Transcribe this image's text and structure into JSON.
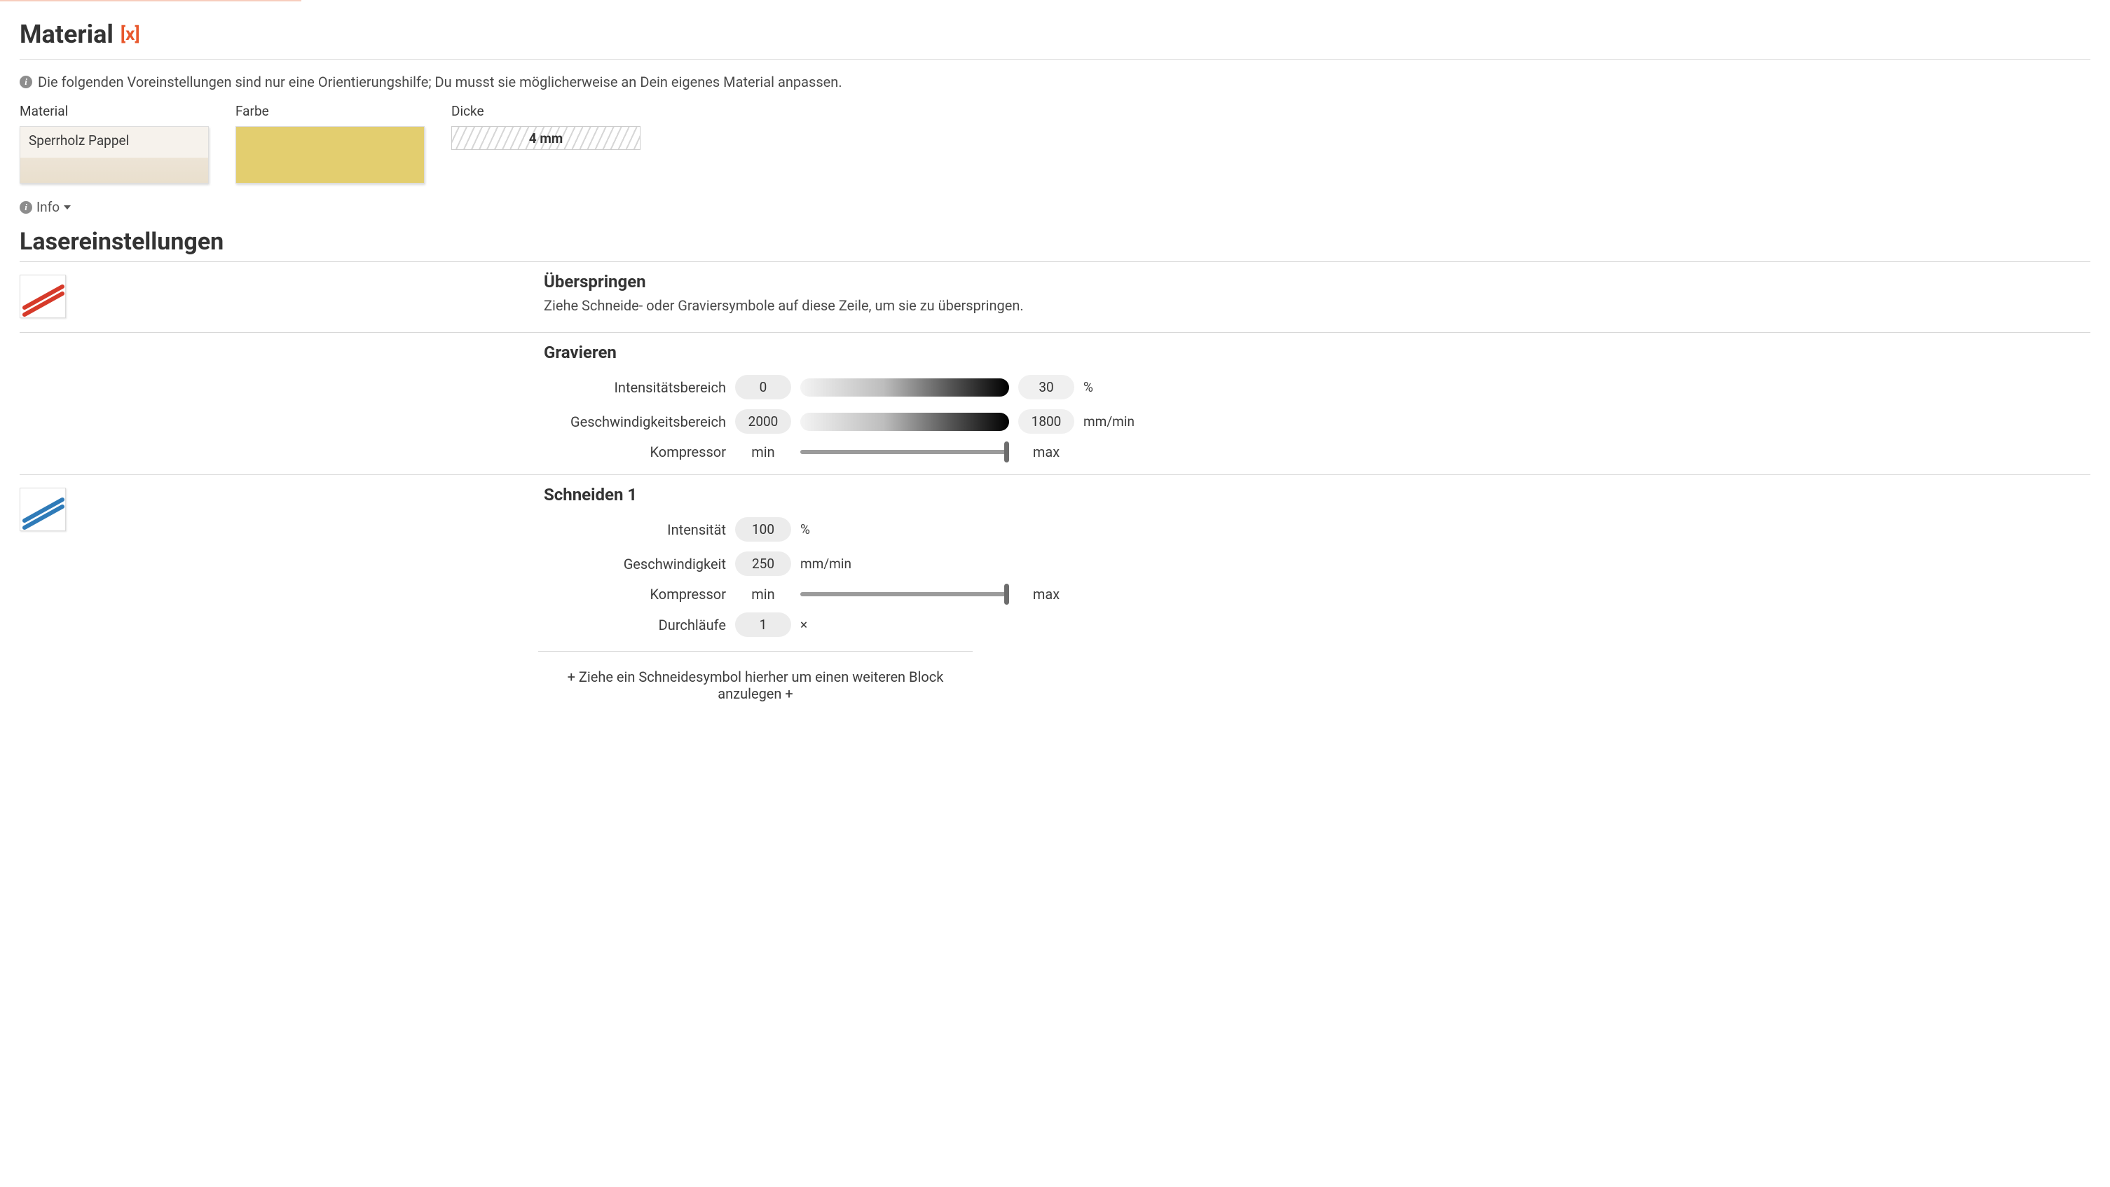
{
  "header": {
    "title": "Material",
    "clear_symbol": "[x]"
  },
  "hint": "Die folgenden Voreinstellungen sind nur eine Orientierungshilfe; Du musst sie möglicherweise an Dein eigenes Material anpassen.",
  "material": {
    "label_material": "Material",
    "label_color": "Farbe",
    "label_thickness": "Dicke",
    "material_name": "Sperrholz Pappel",
    "thickness_value": "4 mm",
    "color_hex": "#e3ce6f",
    "info_label": "Info"
  },
  "laser": {
    "section_title": "Lasereinstellungen",
    "skip": {
      "heading": "Überspringen",
      "desc": "Ziehe Schneide- oder Graviersymbole auf diese Zeile, um sie zu überspringen."
    },
    "engrave": {
      "heading": "Gravieren",
      "intensity_label": "Intensitätsbereich",
      "intensity_from": "0",
      "intensity_to": "30",
      "intensity_unit": "%",
      "speed_label": "Geschwindigkeitsbereich",
      "speed_from": "2000",
      "speed_to": "1800",
      "speed_unit": "mm/min",
      "compressor_label": "Kompressor",
      "min": "min",
      "max": "max"
    },
    "cut1": {
      "heading": "Schneiden 1",
      "intensity_label": "Intensität",
      "intensity_value": "100",
      "intensity_unit": "%",
      "speed_label": "Geschwindigkeit",
      "speed_value": "250",
      "speed_unit": "mm/min",
      "compressor_label": "Kompressor",
      "min": "min",
      "max": "max",
      "passes_label": "Durchläufe",
      "passes_value": "1",
      "passes_unit": "×"
    },
    "add_hint": "+ Ziehe ein Schneidesymbol hierher um einen weiteren Block anzulegen +"
  }
}
